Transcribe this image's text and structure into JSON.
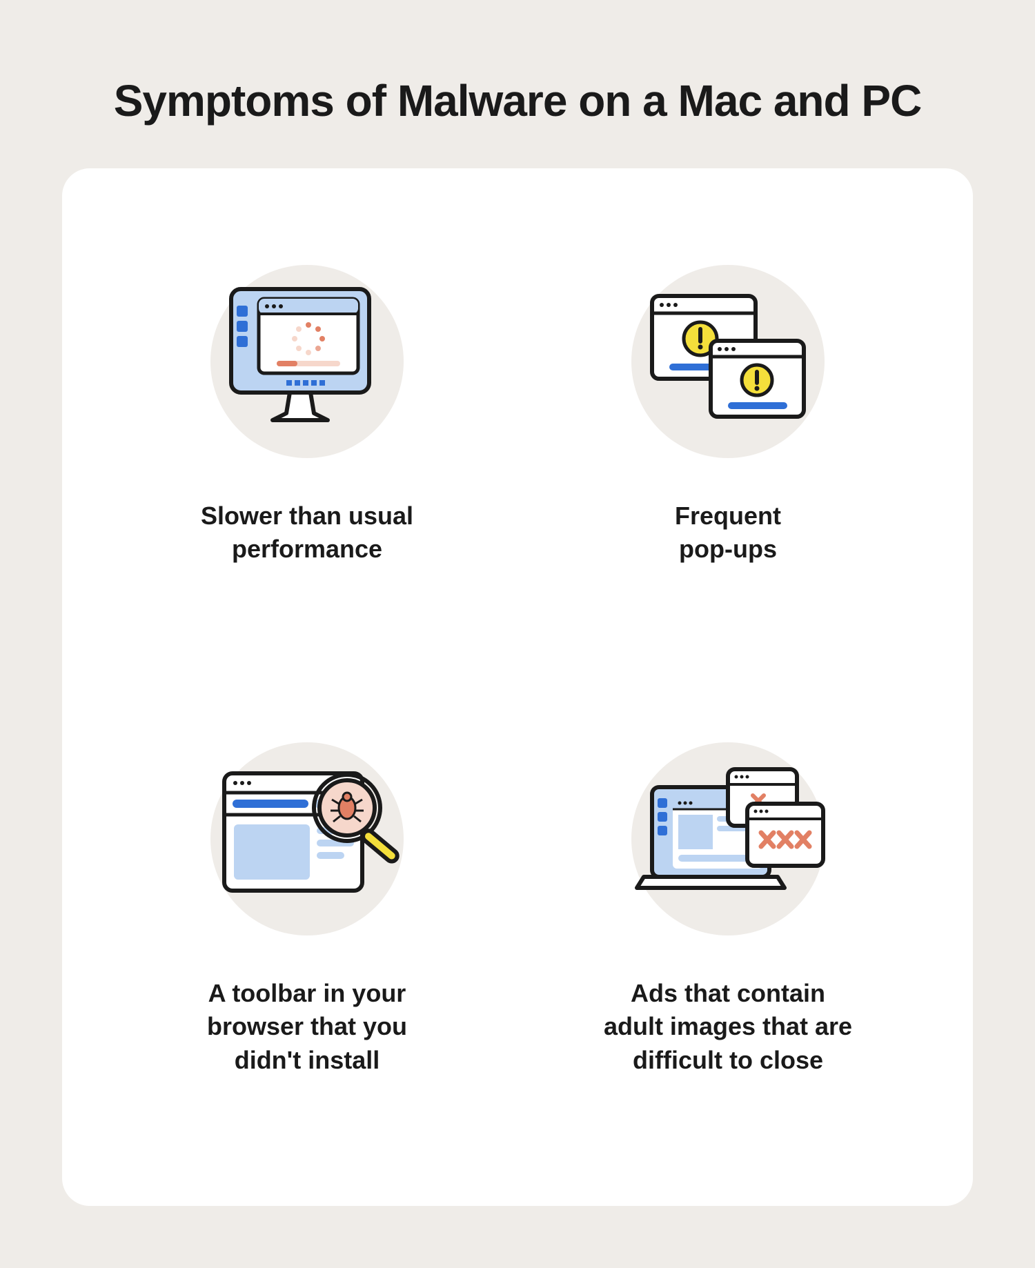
{
  "title": "Symptoms of Malware\non a Mac and PC",
  "items": [
    {
      "icon": "slow-computer-icon",
      "label": "Slower than usual\nperformance"
    },
    {
      "icon": "popup-warning-icon",
      "label": "Frequent\npop-ups"
    },
    {
      "icon": "toolbar-magnify-icon",
      "label": "A toolbar in your\nbrowser that you\ndidn't install"
    },
    {
      "icon": "laptop-ads-icon",
      "label": "Ads that contain\nadult images that are\ndifficult to close"
    }
  ],
  "colors": {
    "bg_page": "#efece8",
    "bg_card": "#ffffff",
    "stroke": "#1a1a1a",
    "blue_light": "#bcd4f2",
    "blue": "#2f6fd6",
    "yellow": "#f4df3b",
    "salmon": "#e28064",
    "pink": "#f6d7cb"
  }
}
